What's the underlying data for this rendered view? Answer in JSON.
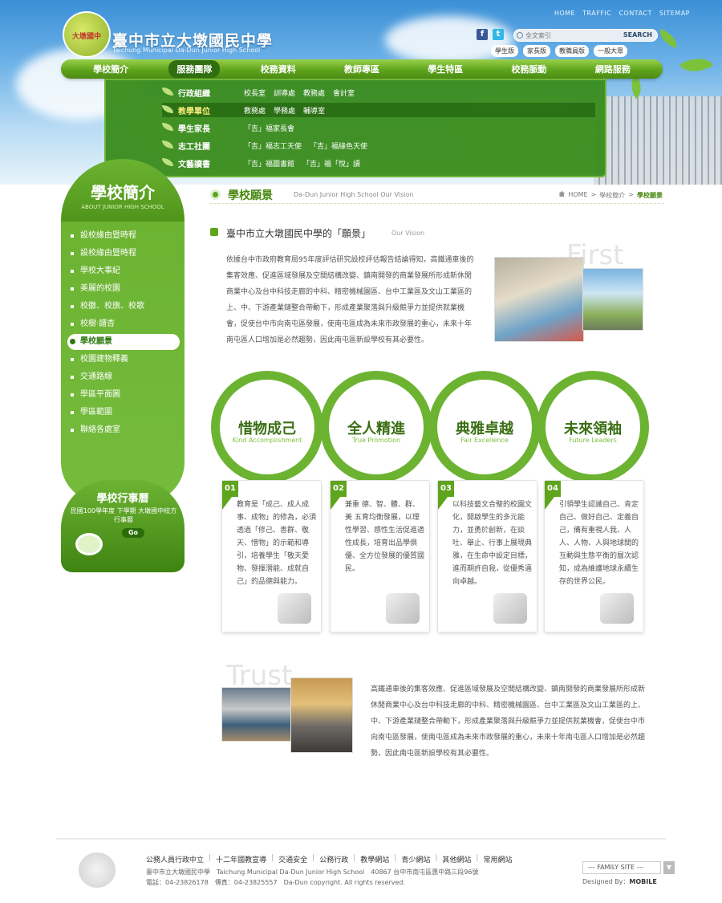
{
  "header": {
    "logo_text": "大墩國中",
    "school_name": "臺中市立大墩國民中學",
    "school_name_en": "Taichung Municipal Da-Dun Junior High School",
    "top_links": [
      "HOME",
      "TRAFFIC",
      "CONTACT",
      "SITEMAP"
    ],
    "search_placeholder": "全文索引",
    "search_button": "SEARCH",
    "user_links": [
      "學生版",
      "家長版",
      "教職員版",
      "一般大眾"
    ]
  },
  "nav": {
    "items": [
      "學校簡介",
      "服務團隊",
      "校務資料",
      "教師專區",
      "學生特區",
      "校務脈動",
      "網路服務"
    ],
    "active_index": 1
  },
  "dropdown": {
    "rows": [
      {
        "category": "行政組織",
        "subs": [
          "校長室",
          "訓導處",
          "教務處",
          "會計室"
        ]
      },
      {
        "category": "教學單位",
        "subs": [
          "教務處",
          "學務處",
          "輔導室"
        ]
      },
      {
        "category": "學生家長",
        "subs": [
          "「吉」福家長會"
        ]
      },
      {
        "category": "志工社團",
        "subs": [
          "「吉」福志工天使",
          "「吉」福綠色天使"
        ]
      },
      {
        "category": "文藝讀書",
        "subs": [
          "「吉」福圖書館",
          "「吉」福「悅」讀"
        ]
      }
    ],
    "selected_index": 1
  },
  "sidebar": {
    "title": "學校簡介",
    "subtitle": "ABOUT JUNIOR HIGH SCHOOL",
    "items": [
      "設校緣由暨時程",
      "設校緣由暨時程",
      "學校大事紀",
      "美麗的校園",
      "校徽、校旗、校歌",
      "校樹‧譜杏",
      "學校願景",
      "校園建物釋義",
      "交通路線",
      "學區平面圖",
      "學區範圍",
      "聯絡各處室"
    ],
    "active_index": 6
  },
  "calendar": {
    "title": "學校行事曆",
    "text": "民國100學年度 下學期 大墩國中校方行事曆",
    "go": "Go"
  },
  "page": {
    "title": "學校願景",
    "subtitle": "Da-Dun Junior High School Our Vision",
    "breadcrumb": [
      "HOME",
      ">",
      "學校簡介",
      ">",
      "學校願景"
    ]
  },
  "section": {
    "heading": "臺中市立大墩國民中學的「願景」",
    "heading_en": "Our Vision",
    "ghost1": "First",
    "para1": "依據台中市政府教育局95年度評估研究設校評估報告結論得知，高鐵通車後的集客效應、促進區域發展及空間結構改變、鎮南開發的商業發展所形成新休閒商業中心及台中科技走廊的中科、精密機械園區、台中工業區及文山工業區的上、中、下游產業鏈整合帶動下，形成產業聚落與升級競爭力並提供就業機會，促使台中市向南屯區發展，使南屯區成為未來市政發展的重心，未來十年南屯區人口增加是必然趨勢，因此南屯區新設學校有其必要性。",
    "ghost2": "Trust",
    "para2": "高鐵通車後的集客效應、促進區域發展及空間結構改變、鎮南開發的商業發展所形成新休閒商業中心及台中科技走廊的中科、精密機械園區、台中工業區及文山工業區的上、中、下游產業鏈整合帶動下，形成產業聚落與升級競爭力並提供就業機會，促使台中市向南屯區發展，使南屯區成為未來市政發展的重心，未來十年南屯區人口增加是必然趨勢，因此南屯區新設學校有其必要性。"
  },
  "visions": [
    {
      "num": "01.",
      "title": "惜物成己",
      "en": "Kind Accomplishment",
      "tag": "01",
      "body": "教育是「成己、成人成事、成物」的修為，必須透過「修己、善群、敬天、惜物」的示範和導引，培養學生「敬天愛物、發揮潛能、成就自己」的品德與能力。"
    },
    {
      "num": "02.",
      "title": "全人精進",
      "en": "True Promotion",
      "tag": "02",
      "body": "兼重 德、智、體、群、美 五育均衡發展，以理性學習、感性生活促進適性成長，培育出品學俱優、全方位發展的優質國民。"
    },
    {
      "num": "03.",
      "title": "典雅卓越",
      "en": "Fair Excellence",
      "tag": "03",
      "body": "以科技藝文合璧的校園文化，開啟學生的多元能力，並勇於創新，在談吐、舉止、行事上展現典雅，在生命中設定目標，進而期許自我，從優秀邁向卓越。"
    },
    {
      "num": "04.",
      "title": "未來領袖",
      "en": "Future Leaders",
      "tag": "04",
      "body": "引領學生認識自己、肯定自己、做好自己、定義自己，備有重視人我、人人、人物、人與地球間的互動與生態平衡的層次認知，成為維護地球永續生存的世界公民。"
    }
  ],
  "footer": {
    "links": [
      "公務人員行政中立",
      "十二年國教宣導",
      "交通安全",
      "公務行政",
      "教學網站",
      "青少網站",
      "其他網站",
      "常用網站"
    ],
    "address": "臺中市立大墩國民中學　Taichung Municipal Da-Dun Junior High School　40867 台中市南屯區惠中路三段96號",
    "contact": "電話：04-23826178　傳真：04-23825557　Da-Dun copyright. All rights reserved.",
    "family_site": "--- FAMILY SITE ---",
    "designed_by_label": "Designed By：",
    "designed_by": "MOBILE"
  },
  "colors": {
    "brand_green": "#5ea41c",
    "dark_green": "#2f6f10",
    "sky_blue": "#3a8fd6"
  }
}
